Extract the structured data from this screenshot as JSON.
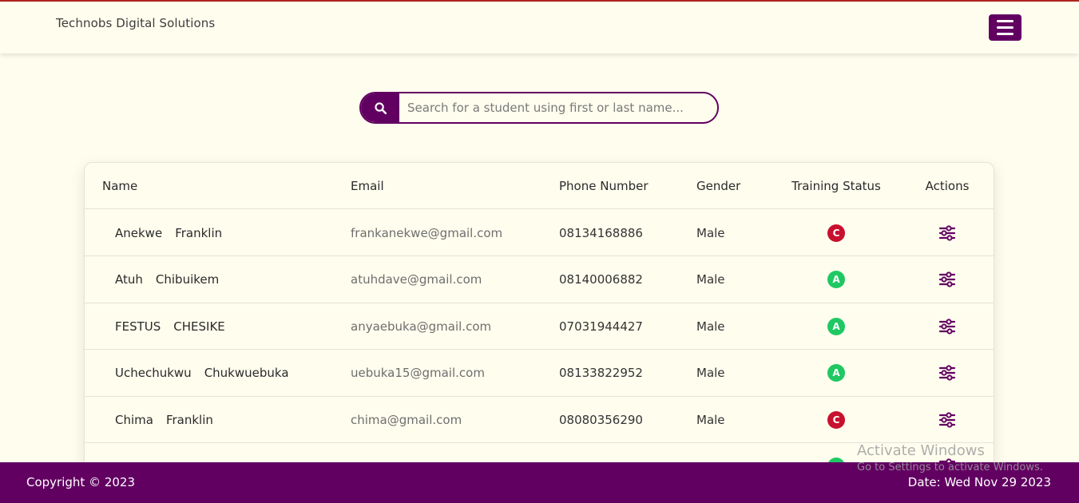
{
  "header": {
    "brand": "Technobs Digital Solutions",
    "menu_icon": "hamburger-menu-icon"
  },
  "search": {
    "placeholder": "Search for a student using first or last name...",
    "value": "",
    "icon": "search-icon"
  },
  "table": {
    "columns": {
      "name": "Name",
      "email": "Email",
      "phone": "Phone Number",
      "gender": "Gender",
      "status": "Training Status",
      "actions": "Actions"
    },
    "rows": [
      {
        "first": "Anekwe",
        "last": "Franklin",
        "email": "frankanekwe@gmail.com",
        "phone": "08134168886",
        "gender": "Male",
        "status": "C",
        "status_color": "#c8102e"
      },
      {
        "first": "Atuh",
        "last": "Chibuikem",
        "email": "atuhdave@gmail.com",
        "phone": "08140006882",
        "gender": "Male",
        "status": "A",
        "status_color": "#1fc862"
      },
      {
        "first": "FESTUS",
        "last": "CHESIKE",
        "email": "anyaebuka@gmail.com",
        "phone": "07031944427",
        "gender": "Male",
        "status": "A",
        "status_color": "#1fc862"
      },
      {
        "first": "Uchechukwu",
        "last": "Chukwuebuka",
        "email": "uebuka15@gmail.com",
        "phone": "08133822952",
        "gender": "Male",
        "status": "A",
        "status_color": "#1fc862"
      },
      {
        "first": "Chima",
        "last": "Franklin",
        "email": "chima@gmail.com",
        "phone": "08080356290",
        "gender": "Male",
        "status": "C",
        "status_color": "#c8102e"
      },
      {
        "first": "",
        "last": "",
        "email": "",
        "phone": "",
        "gender": "",
        "status": "A",
        "status_color": "#1fc862"
      }
    ],
    "action_icon": "sliders-icon"
  },
  "footer": {
    "copyright": "Copyright © 2023",
    "date": "Date: Wed Nov 29 2023"
  },
  "watermark": {
    "line1": "Activate Windows",
    "line2": "Go to Settings to activate Windows."
  },
  "colors": {
    "brand": "#620062",
    "background": "#fffdee",
    "status_complete": "#c8102e",
    "status_active": "#1fc862"
  }
}
